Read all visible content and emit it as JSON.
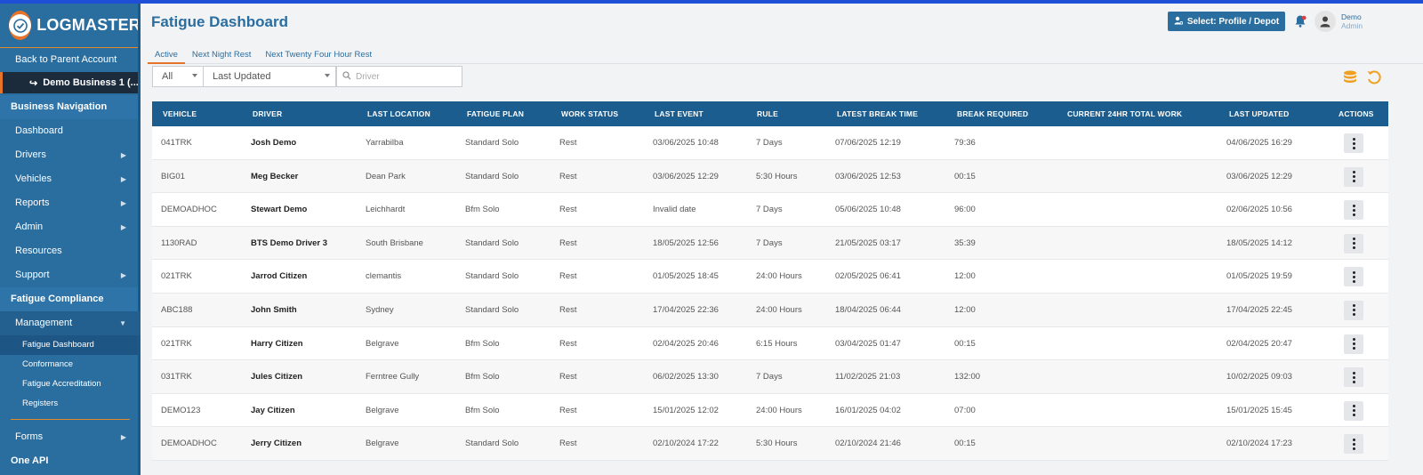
{
  "app": {
    "logo_text": "LOGMASTER",
    "page_title": "Fatigue Dashboard"
  },
  "header": {
    "profile_button": "Select: Profile / Depot",
    "user_name": "Demo",
    "user_role": "Admin"
  },
  "sidebar": {
    "back_link": "Back to Parent Account",
    "business": "Demo Business 1 (...",
    "section_business": "Business Navigation",
    "items": [
      {
        "label": "Dashboard",
        "caret": false
      },
      {
        "label": "Drivers",
        "caret": true
      },
      {
        "label": "Vehicles",
        "caret": true
      },
      {
        "label": "Reports",
        "caret": true
      },
      {
        "label": "Admin",
        "caret": true
      },
      {
        "label": "Resources",
        "caret": false
      },
      {
        "label": "Support",
        "caret": true
      }
    ],
    "section_fatigue": "Fatigue Compliance",
    "management": "Management",
    "sub_items": [
      "Fatigue Dashboard",
      "Conformance",
      "Fatigue Accreditation",
      "Registers"
    ],
    "forms": "Forms",
    "one_api": "One API"
  },
  "tabs": [
    "Active",
    "Next Night Rest",
    "Next Twenty Four Hour Rest"
  ],
  "filters": {
    "status": "All",
    "sort": "Last Updated",
    "search_placeholder": "Driver"
  },
  "table": {
    "columns": [
      "VEHICLE",
      "DRIVER",
      "LAST LOCATION",
      "FATIGUE PLAN",
      "WORK STATUS",
      "LAST EVENT",
      "RULE",
      "LATEST BREAK TIME",
      "BREAK REQUIRED",
      "CURRENT 24HR TOTAL WORK",
      "LAST UPDATED",
      "ACTIONS"
    ],
    "rows": [
      [
        "041TRK",
        "Josh Demo",
        "Yarrabilba",
        "Standard Solo",
        "Rest",
        "03/06/2025 10:48",
        "7 Days",
        "07/06/2025 12:19",
        "79:36",
        "",
        "04/06/2025 16:29"
      ],
      [
        "BIG01",
        "Meg Becker",
        "Dean Park",
        "Standard Solo",
        "Rest",
        "03/06/2025 12:29",
        "5:30 Hours",
        "03/06/2025 12:53",
        "00:15",
        "",
        "03/06/2025 12:29"
      ],
      [
        "DEMOADHOC",
        "Stewart Demo",
        "Leichhardt",
        "Bfm Solo",
        "Rest",
        "Invalid date",
        "7 Days",
        "05/06/2025 10:48",
        "96:00",
        "",
        "02/06/2025 10:56"
      ],
      [
        "1130RAD",
        "BTS Demo Driver 3",
        "South Brisbane",
        "Standard Solo",
        "Rest",
        "18/05/2025 12:56",
        "7 Days",
        "21/05/2025 03:17",
        "35:39",
        "",
        "18/05/2025 14:12"
      ],
      [
        "021TRK",
        "Jarrod Citizen",
        "clemantis",
        "Standard Solo",
        "Rest",
        "01/05/2025 18:45",
        "24:00 Hours",
        "02/05/2025 06:41",
        "12:00",
        "",
        "01/05/2025 19:59"
      ],
      [
        "ABC188",
        "John Smith",
        "Sydney",
        "Standard Solo",
        "Rest",
        "17/04/2025 22:36",
        "24:00 Hours",
        "18/04/2025 06:44",
        "12:00",
        "",
        "17/04/2025 22:45"
      ],
      [
        "021TRK",
        "Harry Citizen",
        "Belgrave",
        "Bfm Solo",
        "Rest",
        "02/04/2025 20:46",
        "6:15 Hours",
        "03/04/2025 01:47",
        "00:15",
        "",
        "02/04/2025 20:47"
      ],
      [
        "031TRK",
        "Jules Citizen",
        "Ferntree Gully",
        "Bfm Solo",
        "Rest",
        "06/02/2025 13:30",
        "7 Days",
        "11/02/2025 21:03",
        "132:00",
        "",
        "10/02/2025 09:03"
      ],
      [
        "DEMO123",
        "Jay Citizen",
        "Belgrave",
        "Bfm Solo",
        "Rest",
        "15/01/2025 12:02",
        "24:00 Hours",
        "16/01/2025 04:02",
        "07:00",
        "",
        "15/01/2025 15:45"
      ],
      [
        "DEMOADHOC",
        "Jerry Citizen",
        "Belgrave",
        "Standard Solo",
        "Rest",
        "02/10/2024 17:22",
        "5:30 Hours",
        "02/10/2024 21:46",
        "00:15",
        "",
        "02/10/2024 17:23"
      ]
    ]
  },
  "colors": {
    "sidebar": "#2a6d9f",
    "header_row": "#1c5d8f",
    "accent": "#e5732a"
  }
}
